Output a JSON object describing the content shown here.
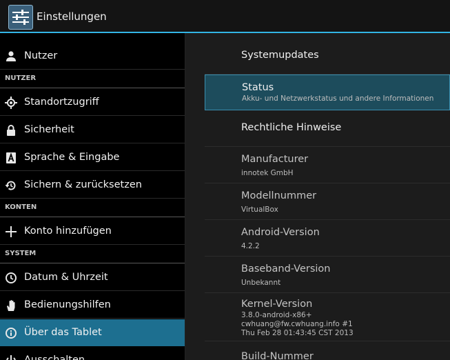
{
  "app": {
    "title": "Einstellungen"
  },
  "sidebar": {
    "items": [
      {
        "kind": "item",
        "label": "Nutzer",
        "icon": "person-icon"
      },
      {
        "kind": "header",
        "label": "NUTZER"
      },
      {
        "kind": "item",
        "label": "Standortzugriff",
        "icon": "location-icon"
      },
      {
        "kind": "item",
        "label": "Sicherheit",
        "icon": "lock-icon"
      },
      {
        "kind": "item",
        "label": "Sprache & Eingabe",
        "icon": "keyboard-a-icon"
      },
      {
        "kind": "item",
        "label": "Sichern & zurücksetzen",
        "icon": "backup-restore-icon"
      },
      {
        "kind": "header",
        "label": "KONTEN"
      },
      {
        "kind": "item",
        "label": "Konto hinzufügen",
        "icon": "plus-icon"
      },
      {
        "kind": "header",
        "label": "SYSTEM"
      },
      {
        "kind": "item",
        "label": "Datum & Uhrzeit",
        "icon": "clock-icon"
      },
      {
        "kind": "item",
        "label": "Bedienungshilfen",
        "icon": "hand-icon"
      },
      {
        "kind": "item",
        "label": "Über das Tablet",
        "icon": "info-icon",
        "active": true
      },
      {
        "kind": "item",
        "label": "Ausschalten",
        "icon": "power-icon"
      }
    ]
  },
  "content": {
    "rows": [
      {
        "title": "Systemupdates",
        "lines": []
      },
      {
        "title": "Status",
        "lines": [
          "Akku- und Netzwerkstatus und andere Informationen"
        ],
        "selected": true
      },
      {
        "title": "Rechtliche Hinweise",
        "lines": []
      },
      {
        "title": "Manufacturer",
        "lines": [
          "innotek GmbH"
        ]
      },
      {
        "title": "Modellnummer",
        "lines": [
          "VirtualBox"
        ]
      },
      {
        "title": "Android-Version",
        "lines": [
          "4.2.2"
        ]
      },
      {
        "title": "Baseband-Version",
        "lines": [
          "Unbekannt"
        ]
      },
      {
        "title": "Kernel-Version",
        "lines": [
          "3.8.0-android-x86+",
          "cwhuang@fw.cwhuang.info #1",
          "Thu Feb 28 01:43:45 CST 2013"
        ]
      },
      {
        "title": "Build-Nummer",
        "lines": []
      }
    ]
  },
  "colors": {
    "accent": "#33b5e5",
    "active_item": "#1d6f90",
    "selected_row": "#1d4c5c"
  }
}
